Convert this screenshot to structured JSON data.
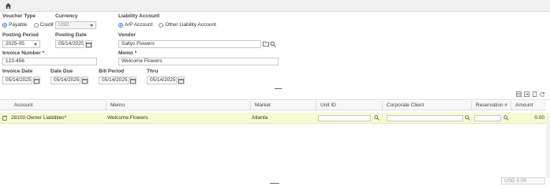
{
  "form": {
    "voucher_type": {
      "label": "Voucher Type",
      "options": [
        "Payable",
        "Credit"
      ],
      "selected": "Payable"
    },
    "currency": {
      "label": "Currency",
      "value": "USD"
    },
    "liability_account": {
      "label": "Liability Account",
      "options": [
        "A/P Account",
        "Other Liability Account"
      ],
      "selected": "A/P Account"
    },
    "posting_period": {
      "label": "Posting Period",
      "value": "2025-05"
    },
    "posting_date": {
      "label": "Posting Date",
      "value": "05/14/2025"
    },
    "vendor": {
      "label": "Vendor",
      "value": "Sallys Flowers"
    },
    "invoice_number": {
      "label": "Invoice Number *",
      "value": "123-456"
    },
    "memo": {
      "label": "Memo *",
      "value": "Welcome Flowers"
    },
    "invoice_date": {
      "label": "Invoice Date",
      "value": "05/14/2025"
    },
    "date_due": {
      "label": "Date Due",
      "value": "05/14/2025"
    },
    "bill_period": {
      "label": "Bill Period",
      "value": "05/14/2025"
    },
    "thru": {
      "label": "Thru",
      "value": "05/14/2025"
    }
  },
  "grid": {
    "columns": [
      "Account",
      "Memo",
      "Market",
      "Unit ID",
      "Corporate Client",
      "Reservation #",
      "Amount"
    ],
    "rows": [
      {
        "account": "28100 Owner Liabilities*",
        "memo": "Welcome Flowers",
        "market": "Atlanta",
        "unit_id": "",
        "corporate_client": "",
        "reservation": "",
        "amount": "0.00"
      }
    ],
    "total": "USD 0.00"
  },
  "icons": {
    "home": "home-icon",
    "calendar": "calendar-icon",
    "search": "search-icon",
    "folder": "folder-icon",
    "trash": "trash-icon",
    "grid_tools": [
      "columns-icon",
      "export-icon",
      "copy-icon",
      "refresh-icon"
    ]
  },
  "colors": {
    "row_highlight": "#fafad2",
    "radio_accent": "#3a78c3"
  }
}
